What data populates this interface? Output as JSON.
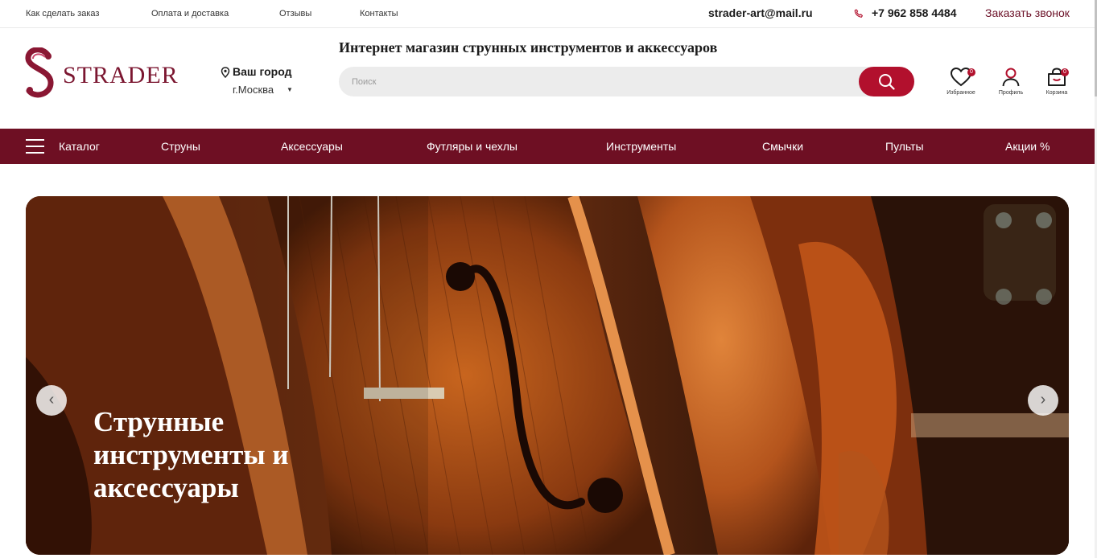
{
  "topbar": {
    "links": [
      "Как сделать заказ",
      "Оплата и доставка",
      "Отзывы",
      "Контакты"
    ],
    "email": "strader-art@mail.ru",
    "phone": "+7 962 858 4484",
    "callback": "Заказать звонок"
  },
  "header": {
    "logo_text": "STRADER",
    "city_label": "Ваш город",
    "city_value": "г.Москва",
    "tagline": "Интернет магазин струнных инструментов и аккессуаров",
    "search_placeholder": "Поиск",
    "icons": {
      "favorites": {
        "label": "Избранное",
        "count": "0"
      },
      "profile": {
        "label": "Профиль"
      },
      "cart": {
        "label": "Корзина",
        "count": "0"
      }
    }
  },
  "nav": {
    "catalog": "Каталог",
    "items": [
      "Струны",
      "Аксессуары",
      "Футляры и чехлы",
      "Инструменты",
      "Смычки",
      "Пульты",
      "Акции %"
    ]
  },
  "banner": {
    "title": "Струнные инструменты и аксессуары",
    "prev": "‹",
    "next": "›"
  },
  "colors": {
    "brand": "#6e0f23",
    "accent": "#b2102d"
  }
}
